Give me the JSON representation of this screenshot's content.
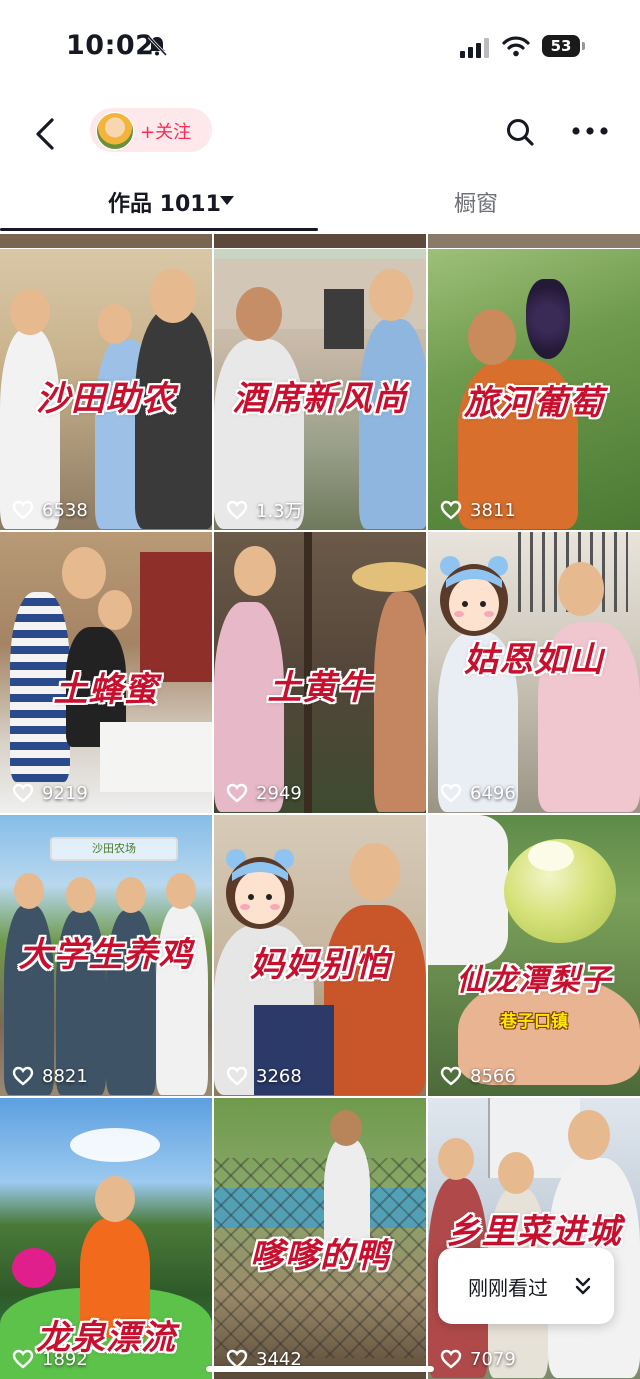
{
  "status_bar": {
    "time": "10:02",
    "battery": "53"
  },
  "header": {
    "follow_label": "+关注"
  },
  "tabs": {
    "works_label": "作品 1011",
    "window_label": "橱窗"
  },
  "videos": [
    {
      "title": "沙田助农",
      "likes": "6538"
    },
    {
      "title": "酒席新风尚",
      "likes": "1.3万"
    },
    {
      "title": "旅河葡萄",
      "likes": "3811"
    },
    {
      "title": "土蜂蜜",
      "likes": "9219"
    },
    {
      "title": "土黄牛",
      "likes": "2949"
    },
    {
      "title": "姑恩如山",
      "likes": "6496"
    },
    {
      "title": "大学生养鸡",
      "likes": "8821",
      "sign": "沙田农场"
    },
    {
      "title": "妈妈别怕",
      "likes": "3268"
    },
    {
      "title": "仙龙潭梨子",
      "subtitle": "巷子口镇",
      "likes": "8566"
    },
    {
      "title": "龙泉漂流",
      "likes": "1892"
    },
    {
      "title": "嗲嗲的鸭",
      "likes": "3442"
    },
    {
      "title": "乡里菜进城",
      "likes": "7079"
    }
  ],
  "recent_button": {
    "label": "刚刚看过"
  },
  "icons": [
    "bell-off-icon",
    "signal-icon",
    "wifi-icon",
    "battery-icon",
    "back-arrow-icon",
    "search-icon",
    "more-icon",
    "caret-down-icon",
    "heart-icon",
    "double-chevron-down-icon"
  ]
}
